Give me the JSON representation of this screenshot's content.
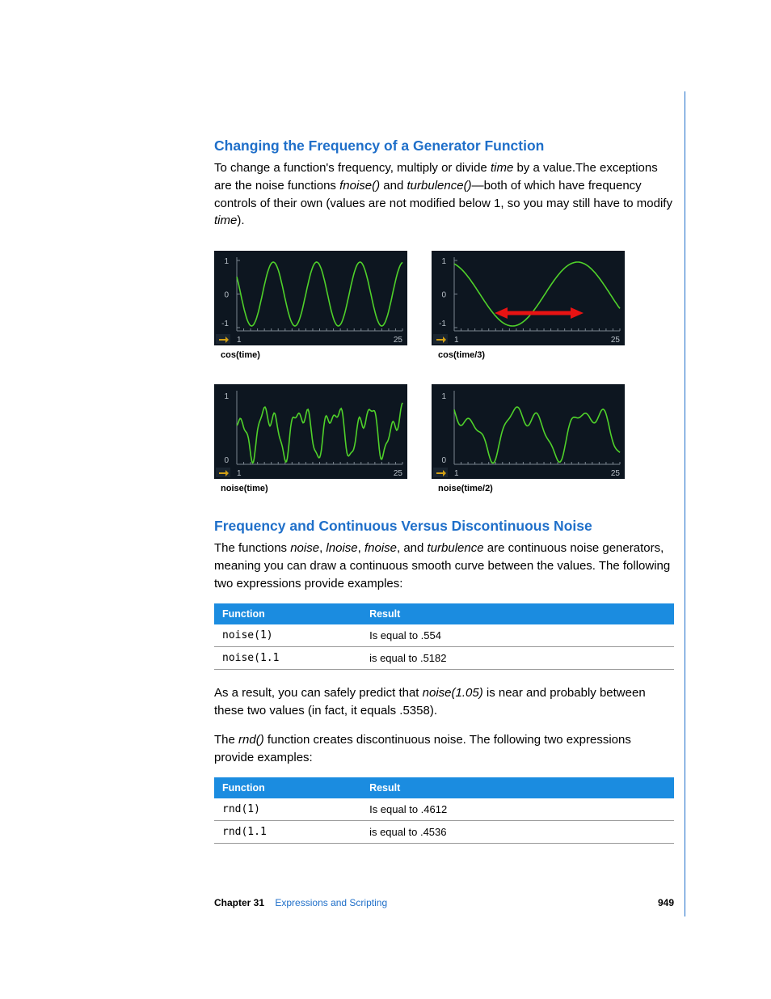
{
  "section1": {
    "title": "Changing the Frequency of a Generator Function",
    "para": "To change a function's frequency, multiply or divide <em>time</em> by a value.The exceptions are the noise functions <em>fnoise()</em> and <em>turbulence()</em>—both of which have frequency controls of their own (values are not modified below 1, so you may still have to modify <em>time</em>)."
  },
  "charts": {
    "row1": [
      {
        "caption": "cos(time)",
        "ylabels": [
          "1",
          "0",
          "-1"
        ],
        "x1": "1",
        "x25": "25",
        "type": "cos",
        "freq": 1,
        "arrow": false
      },
      {
        "caption": "cos(time/3)",
        "ylabels": [
          "1",
          "0",
          "-1"
        ],
        "x1": "1",
        "x25": "25",
        "type": "cos",
        "freq": 0.333,
        "arrow": true
      }
    ],
    "row2": [
      {
        "caption": "noise(time)",
        "ylabels": [
          "1",
          "0"
        ],
        "x1": "1",
        "x25": "25",
        "type": "noise",
        "freq": 1,
        "arrow": false
      },
      {
        "caption": "noise(time/2)",
        "ylabels": [
          "1",
          "0"
        ],
        "x1": "1",
        "x25": "25",
        "type": "noise",
        "freq": 0.5,
        "arrow": false
      }
    ]
  },
  "section2": {
    "title": "Frequency and Continuous Versus Discontinuous Noise",
    "para1": "The functions <em>noise</em>, <em>lnoise</em>, <em>fnoise</em>, and <em>turbulence</em> are continuous noise generators, meaning you can draw a continuous smooth curve between the values. The following two expressions provide examples:",
    "table1": {
      "headers": [
        "Function",
        "Result"
      ],
      "rows": [
        {
          "func": "noise(1)",
          "res": "Is equal to .554"
        },
        {
          "func": "noise(1.1",
          "res": "is equal to .5182"
        }
      ]
    },
    "para2": "As a result, you can safely predict that <em>noise(1.05)</em> is near and probably between these two values (in fact, it equals .5358).",
    "para3": "The <em>rnd()</em> function creates discontinuous noise. The following two expressions provide examples:",
    "table2": {
      "headers": [
        "Function",
        "Result"
      ],
      "rows": [
        {
          "func": "rnd(1)",
          "res": "Is equal to .4612"
        },
        {
          "func": "rnd(1.1",
          "res": "is equal to .4536"
        }
      ]
    }
  },
  "footer": {
    "chapter_label": "Chapter 31",
    "chapter_title": "Expressions and Scripting",
    "page": "949"
  }
}
